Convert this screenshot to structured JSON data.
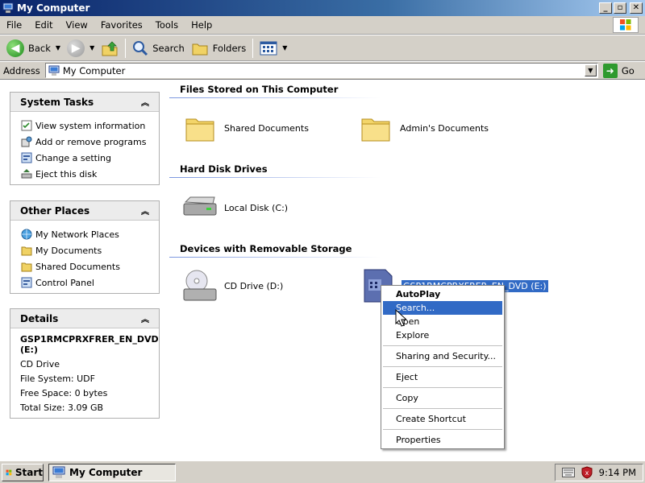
{
  "window": {
    "title": "My Computer"
  },
  "menubar": {
    "items": [
      "File",
      "Edit",
      "View",
      "Favorites",
      "Tools",
      "Help"
    ]
  },
  "toolbar": {
    "back": "Back",
    "search": "Search",
    "folders": "Folders"
  },
  "addressbar": {
    "label": "Address",
    "value": "My Computer",
    "go": "Go"
  },
  "sidebar": {
    "system_tasks": {
      "title": "System Tasks",
      "items": [
        "View system information",
        "Add or remove programs",
        "Change a setting",
        "Eject this disk"
      ]
    },
    "other_places": {
      "title": "Other Places",
      "items": [
        "My Network Places",
        "My Documents",
        "Shared Documents",
        "Control Panel"
      ]
    },
    "details": {
      "title": "Details",
      "name": "GSP1RMCPRXFRER_EN_DVD (E:)",
      "type": "CD Drive",
      "file_system": "File System: UDF",
      "free_space": "Free Space: 0 bytes",
      "total_size": "Total Size: 3.09 GB"
    }
  },
  "main": {
    "sections": [
      {
        "title": "Files Stored on This Computer"
      },
      {
        "title": "Hard Disk Drives"
      },
      {
        "title": "Devices with Removable Storage"
      }
    ],
    "items": {
      "shared_documents": "Shared Documents",
      "admins_documents": "Admin's Documents",
      "local_disk": "Local Disk (C:)",
      "cd_drive": "CD Drive (D:)",
      "dvd_drive": "GSP1RMCPRXFRER_EN_DVD (E:)"
    }
  },
  "context_menu": {
    "items": [
      "AutoPlay",
      "Search...",
      "Open",
      "Explore",
      "Sharing and Security...",
      "Eject",
      "Copy",
      "Create Shortcut",
      "Properties"
    ],
    "highlighted": "Search..."
  },
  "taskbar": {
    "start": "Start",
    "active_window": "My Computer",
    "clock": "9:14 PM"
  },
  "colors": {
    "titlebar": "#0a246a",
    "selection": "#316ac5",
    "chrome": "#d4d0c8"
  }
}
